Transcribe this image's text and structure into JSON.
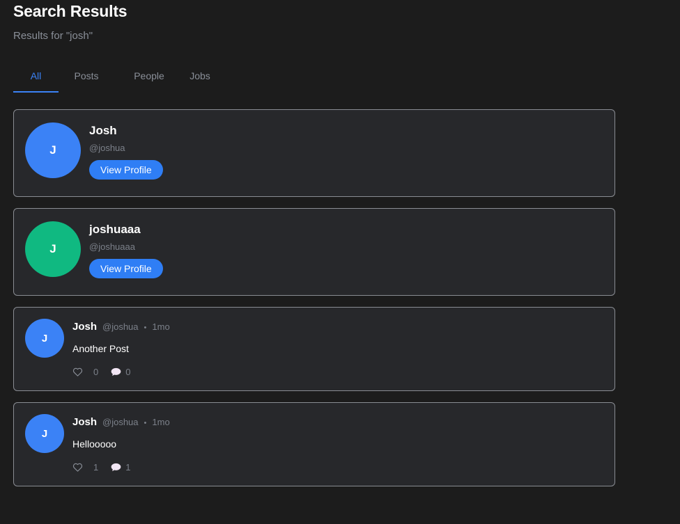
{
  "header": {
    "title": "Search Results",
    "subtitle": "Results for \"josh\""
  },
  "tabs": [
    {
      "label": "All",
      "active": true
    },
    {
      "label": "Posts",
      "active": false
    },
    {
      "label": "People",
      "active": false
    },
    {
      "label": "Jobs",
      "active": false
    }
  ],
  "users": [
    {
      "initial": "J",
      "name": "Josh",
      "handle": "@joshua",
      "button_label": "View Profile",
      "avatar_color": "#3b82f6"
    },
    {
      "initial": "J",
      "name": "joshuaaa",
      "handle": "@joshuaaa",
      "button_label": "View Profile",
      "avatar_color": "#10b981"
    }
  ],
  "posts": [
    {
      "initial": "J",
      "author": "Josh",
      "handle": "@joshua",
      "separator": "•",
      "time": "1mo",
      "body": "Another Post",
      "likes": "0",
      "comments": "0"
    },
    {
      "initial": "J",
      "author": "Josh",
      "handle": "@joshua",
      "separator": "•",
      "time": "1mo",
      "body": "Hellooooo",
      "likes": "1",
      "comments": "1"
    }
  ],
  "icons": {
    "like": "heart-icon",
    "comment": "comment-icon"
  },
  "colors": {
    "background": "#1c1c1c",
    "card": "#27282b",
    "accent": "#3b82f6",
    "button": "#2f7ef5",
    "muted": "#8a8f98"
  }
}
